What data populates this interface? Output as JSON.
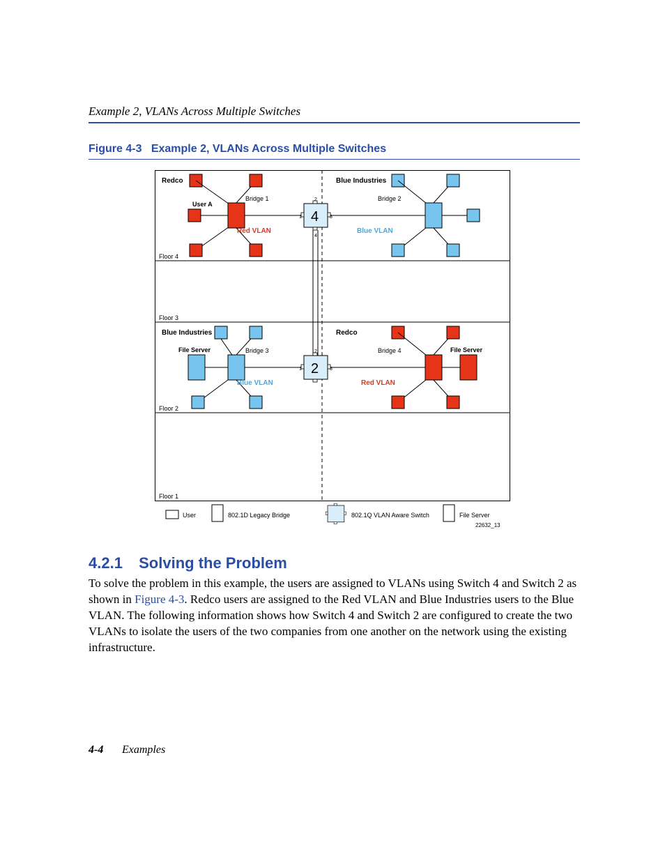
{
  "header": {
    "running": "Example 2, VLANs Across Multiple Switches"
  },
  "figure": {
    "label": "Figure 4-3",
    "title": "Example 2, VLANs Across Multiple Switches"
  },
  "diagram": {
    "floors": [
      "Floor 4",
      "Floor 3",
      "Floor 2",
      "Floor 1"
    ],
    "tl": {
      "company": "Redco",
      "user": "User A",
      "bridge": "Bridge 1",
      "vlan": "Red VLAN"
    },
    "tr": {
      "company": "Blue Industries",
      "bridge": "Bridge 2",
      "vlan": "Blue VLAN"
    },
    "bl": {
      "company": "Blue Industries",
      "server": "File Server",
      "bridge": "Bridge 3",
      "vlan": "Blue VLAN"
    },
    "br": {
      "company": "Redco",
      "server": "File Server",
      "bridge": "Bridge 4",
      "vlan": "Red VLAN"
    },
    "switches": {
      "top": "4",
      "top_ports": [
        "1",
        "2",
        "3",
        "4"
      ],
      "bottom": "2",
      "bottom_ports": [
        "1",
        "2",
        "3"
      ]
    },
    "legend": {
      "user": "User",
      "legacy": "802.1D Legacy Bridge",
      "aware": "802.1Q VLAN Aware Switch",
      "server": "File Server"
    },
    "img_id": "22632_13"
  },
  "section": {
    "number": "4.2.1",
    "title": "Solving the Problem"
  },
  "para": {
    "t1": "To solve the problem in this example, the users are assigned to VLANs using Switch 4 and Switch 2 as shown in ",
    "xref": "Figure 4-3",
    "t2": ". Redco users are assigned to the Red VLAN and Blue Industries users to the Blue VLAN. The following information shows how Switch 4 and Switch 2 are configured to create the two VLANs to isolate the users of the two companies from one another on the network using the existing infrastructure."
  },
  "footer": {
    "page": "4-4",
    "chapter": "Examples"
  }
}
